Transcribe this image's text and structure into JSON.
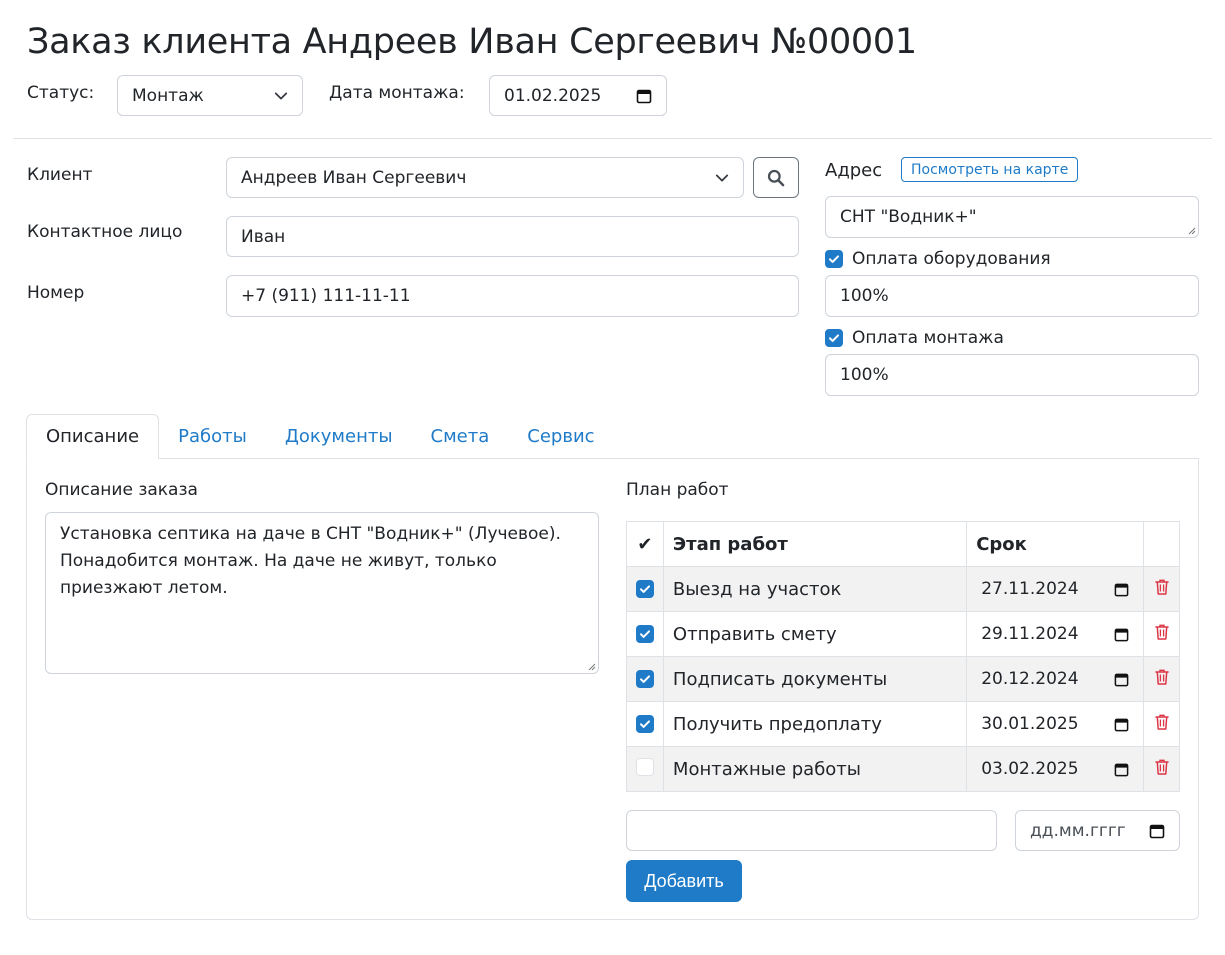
{
  "header": {
    "title": "Заказ клиента Андреев Иван Сергеевич №00001",
    "status_label": "Статус:",
    "status_value": "Монтаж",
    "install_date_label": "Дата монтажа:",
    "install_date_value": "01.02.2025"
  },
  "client": {
    "client_label": "Клиент",
    "client_value": "Андреев Иван Сергеевич",
    "contact_label": "Контактное лицо",
    "contact_value": "Иван",
    "phone_label": "Номер",
    "phone_value": "+7 (911) 111-11-11"
  },
  "address": {
    "label": "Адрес",
    "map_button": "Посмотреть на карте",
    "value": "СНТ \"Водник+\""
  },
  "payments": {
    "equipment_label": "Оплата оборудования",
    "equipment_checked": true,
    "equipment_value": "100%",
    "install_label": "Оплата монтажа",
    "install_checked": true,
    "install_value": "100%"
  },
  "tabs": [
    {
      "label": "Описание",
      "active": true
    },
    {
      "label": "Работы",
      "active": false
    },
    {
      "label": "Документы",
      "active": false
    },
    {
      "label": "Смета",
      "active": false
    },
    {
      "label": "Сервис",
      "active": false
    }
  ],
  "description": {
    "label": "Описание заказа",
    "text": "Установка септика на даче в СНТ \"Водник+\" (Лучевое). Понадобится монтаж. На даче не живут, только приезжают летом."
  },
  "plan": {
    "label": "План работ",
    "columns": [
      "✔",
      "Этап работ",
      "Срок",
      ""
    ],
    "rows": [
      {
        "done": true,
        "stage": "Выезд на участок",
        "date": "27.11.2024"
      },
      {
        "done": true,
        "stage": "Отправить смету",
        "date": "29.11.2024"
      },
      {
        "done": true,
        "stage": "Подписать документы",
        "date": "20.12.2024"
      },
      {
        "done": true,
        "stage": "Получить предоплату",
        "date": "30.01.2025"
      },
      {
        "done": false,
        "stage": "Монтажные работы",
        "date": "03.02.2025"
      }
    ],
    "new_stage_value": "",
    "new_date_placeholder": "дд.мм.гггг",
    "add_button": "Добавить"
  },
  "colors": {
    "accent": "#1f7bc8",
    "danger": "#dc3545",
    "border": "#ced4da"
  }
}
